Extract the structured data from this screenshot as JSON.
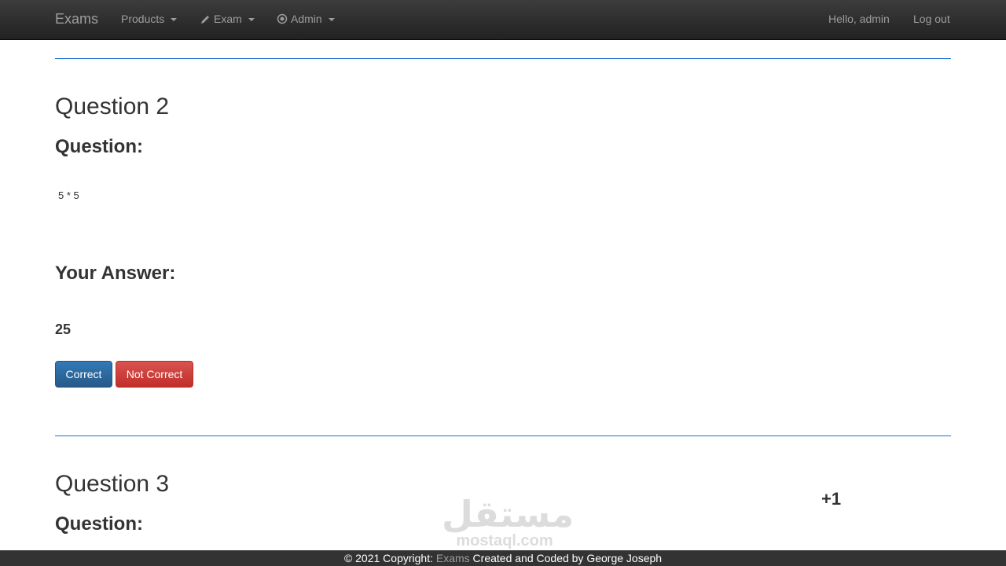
{
  "navbar": {
    "brand": "Exams",
    "items": [
      {
        "label": "Products",
        "icon": ""
      },
      {
        "label": "Exam",
        "icon": "pencil-icon"
      },
      {
        "label": "Admin",
        "icon": "record-icon"
      }
    ],
    "greeting": "Hello, admin",
    "logout": "Log out"
  },
  "questions": [
    {
      "title": "Question 2",
      "question_label": "Question:",
      "question_text": "5 * 5",
      "answer_label": "Your Answer:",
      "answer": "25",
      "correct_button": "Correct",
      "not_correct_button": "Not Correct"
    },
    {
      "title": "Question 3",
      "question_label": "Question:"
    }
  ],
  "score_badge": "+1",
  "watermark": {
    "arabic": "مستقل",
    "latin": "mostaql.com"
  },
  "footer": {
    "prefix": "© 2021 Copyright: ",
    "brand": "Exams",
    "suffix": " Created and Coded by George Joseph"
  },
  "colors": {
    "accent": "#1a6fd0",
    "primary": "#337ab7",
    "danger": "#d9534f",
    "navbar": "#222222"
  }
}
